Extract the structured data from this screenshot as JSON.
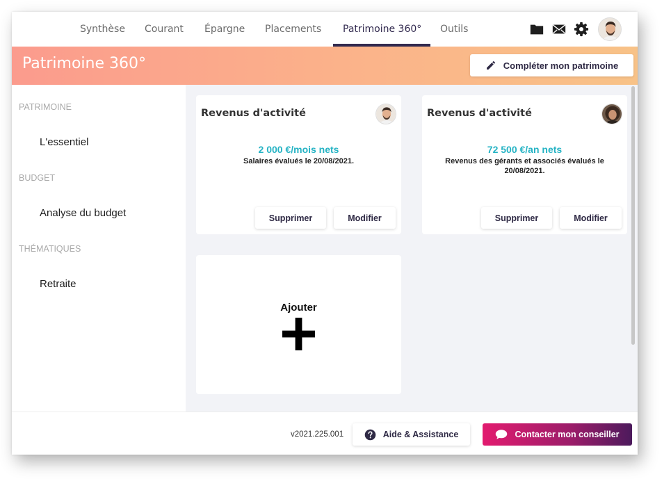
{
  "nav": {
    "tabs": [
      {
        "label": "Synthèse"
      },
      {
        "label": "Courant"
      },
      {
        "label": "Épargne"
      },
      {
        "label": "Placements"
      },
      {
        "label": "Patrimoine 360°",
        "active": true
      },
      {
        "label": "Outils"
      }
    ],
    "icons": [
      "folder-icon",
      "mail-icon",
      "gear-icon",
      "user-avatar"
    ]
  },
  "banner": {
    "title": "Patrimoine 360°",
    "complete_button": "Compléter mon patrimoine",
    "complete_icon": "pencil-icon"
  },
  "sidebar": {
    "sections": [
      {
        "title": "PATRIMOINE",
        "items": [
          "L'essentiel"
        ]
      },
      {
        "title": "BUDGET",
        "items": [
          "Analyse du budget"
        ]
      },
      {
        "title": "THÉMATIQUES",
        "items": [
          "Retraite"
        ]
      }
    ]
  },
  "cards": [
    {
      "title": "Revenus d'activité",
      "value": "2 000 €/mois nets",
      "description": "Salaires évalués le 20/08/2021.",
      "delete_label": "Supprimer",
      "edit_label": "Modifier",
      "avatar": "male-avatar"
    },
    {
      "title": "Revenus d'activité",
      "value": "72 500 €/an nets",
      "description": "Revenus des gérants et associés évalués le 20/08/2021.",
      "delete_label": "Supprimer",
      "edit_label": "Modifier",
      "avatar": "female-avatar"
    }
  ],
  "add_card": {
    "label": "Ajouter",
    "icon": "plus-icon"
  },
  "footer": {
    "version": "v2021.225.001",
    "help_button": "Aide & Assistance",
    "help_icon": "question-circle-icon",
    "contact_button": "Contacter mon conseiller",
    "contact_icon": "chat-bubble-icon"
  },
  "colors": {
    "accent_dark": "#322a4f",
    "value_teal": "#25b3c4",
    "banner_start": "#fb9b8d",
    "banner_end": "#f8c287",
    "contact_start": "#e21b6f",
    "contact_end": "#4c1a5c"
  }
}
